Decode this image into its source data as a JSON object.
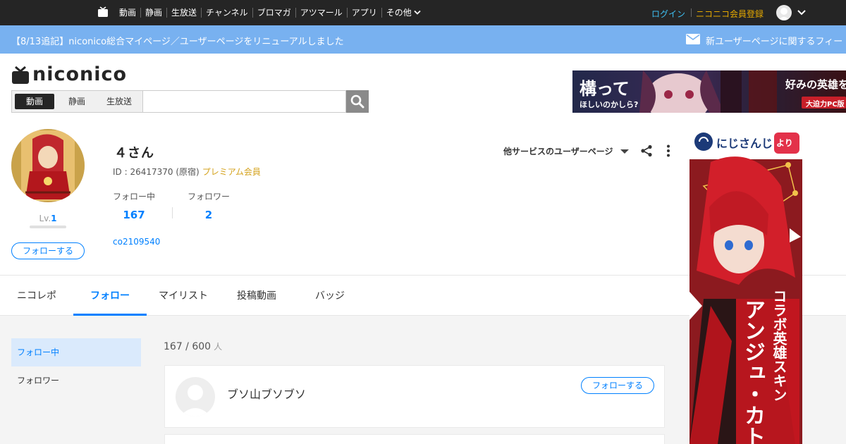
{
  "topbar": {
    "nav": [
      "動画",
      "静画",
      "生放送",
      "チャンネル",
      "ブロマガ",
      "アツマール",
      "アプリ",
      "その他"
    ],
    "login": "ログイン",
    "register": "ニコニコ会員登録"
  },
  "announcement": {
    "text": "【8/13追記】niconico総合マイページ／ユーザーページをリニューアルしました",
    "right_text": "新ユーザーページに関するフィー"
  },
  "header": {
    "logo_text": "niconico",
    "search_tabs": [
      "動画",
      "静画",
      "生放送"
    ],
    "search_placeholder": "",
    "banner_top": {
      "main": "構って",
      "sub": "ほしいのかしら?",
      "right": "好みの英雄を育",
      "badge": "大迫力PC版"
    }
  },
  "profile": {
    "name": "４さん",
    "id_text": "ID : 26417370 (原宿)",
    "premium": "プレミアム会員",
    "level_prefix": "Lv.",
    "level": "1",
    "follow_button": "フォローする",
    "following_label": "フォロー中",
    "following_count": "167",
    "followers_label": "フォロワー",
    "followers_count": "2",
    "community": "co2109540",
    "other_services": "他サービスのユーザーページ"
  },
  "tabs": [
    "ニコレポ",
    "フォロー",
    "マイリスト",
    "投稿動画",
    "バッジ"
  ],
  "sidenav": {
    "active": "フォロー中",
    "item": "フォロワー"
  },
  "list": {
    "count": "167 / 600",
    "unit": "人",
    "items": [
      {
        "name": "ブソ山ブソブソ",
        "follow": "フォローする"
      }
    ]
  },
  "side_banner": {
    "top": "にじさんじ",
    "top2": "より",
    "v1": "コラボ英雄スキン",
    "v2": "アンジュ・カト"
  },
  "colors": {
    "accent": "#0080ff",
    "premium": "#d4a21c",
    "announce": "#78b1f0",
    "topbar": "#252525"
  }
}
